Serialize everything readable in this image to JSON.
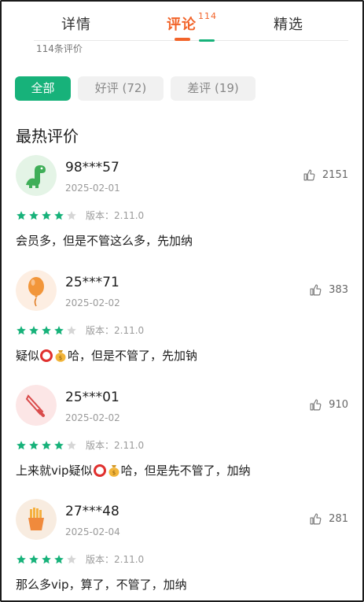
{
  "tabs": [
    {
      "label": "详情",
      "active": false
    },
    {
      "label": "评论",
      "badge": "114",
      "active": true
    },
    {
      "label": "精选",
      "active": false
    }
  ],
  "review_count_text": "114条评价",
  "filters": [
    {
      "label": "全部",
      "active": true
    },
    {
      "label": "好评 (72)",
      "active": false
    },
    {
      "label": "差评 (19)",
      "active": false
    }
  ],
  "section_title": "最热评价",
  "colors": {
    "accent_green": "#17b27a",
    "accent_orange": "#f2642a",
    "star_empty": "#d6d6d6"
  },
  "reviews": [
    {
      "user": "98***57",
      "date": "2025-02-01",
      "likes": "2151",
      "rating": 4,
      "version": "版本：2.11.0",
      "avatar_icon": "dinosaur-icon",
      "content": [
        "会员多，但是不管这么多，先加纳"
      ]
    },
    {
      "user": "25***71",
      "date": "2025-02-02",
      "likes": "383",
      "rating": 4,
      "version": "版本：2.11.0",
      "avatar_icon": "balloon-icon",
      "content": [
        "疑似",
        "哈，但是不管了，先加钠"
      ]
    },
    {
      "user": "25***01",
      "date": "2025-02-02",
      "likes": "910",
      "rating": 4,
      "version": "版本：2.11.0",
      "avatar_icon": "knife-icon",
      "content": [
        "上来就vip疑似",
        "哈，但是先不管了，加纳"
      ]
    },
    {
      "user": "27***48",
      "date": "2025-02-04",
      "likes": "281",
      "rating": 4,
      "version": "版本：2.11.0",
      "avatar_icon": "fries-icon",
      "content": [
        "那么多vip，算了，不管了，加纳"
      ]
    }
  ]
}
